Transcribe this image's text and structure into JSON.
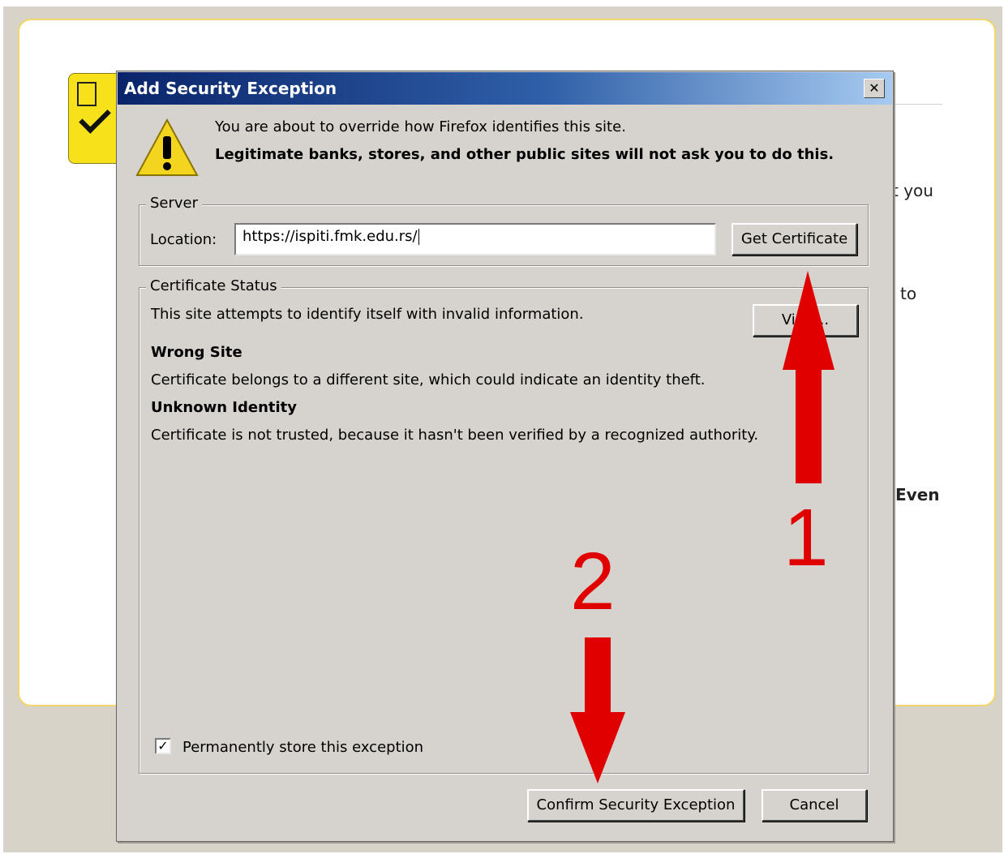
{
  "background_page": {
    "fragments": [
      "t you",
      "to",
      "Even"
    ]
  },
  "dialog": {
    "title": "Add Security Exception",
    "close_glyph": "✕",
    "warning_line1": "You are about to override how Firefox identifies this site.",
    "warning_line2": "Legitimate banks, stores, and other public sites will not ask you to do this.",
    "server": {
      "legend": "Server",
      "location_label": "Location:",
      "location_value": "https://ispiti.fmk.edu.rs/",
      "get_certificate_label": "Get Certificate"
    },
    "certificate_status": {
      "legend": "Certificate Status",
      "summary": "This site attempts to identify itself with invalid information.",
      "view_button_label": "View...",
      "wrong_site_title": "Wrong Site",
      "wrong_site_desc": "Certificate belongs to a different site, which could indicate an identity theft.",
      "unknown_identity_title": "Unknown Identity",
      "unknown_identity_desc": "Certificate is not trusted, because it hasn't been verified by a recognized authority."
    },
    "permanent_checkbox": {
      "checked": true,
      "glyph": "✓",
      "label": "Permanently store this exception"
    },
    "confirm_button_label": "Confirm Security Exception",
    "cancel_button_label": "Cancel"
  },
  "annotations": {
    "arrow_color": "#e00000",
    "step1": "1",
    "step2": "2"
  }
}
